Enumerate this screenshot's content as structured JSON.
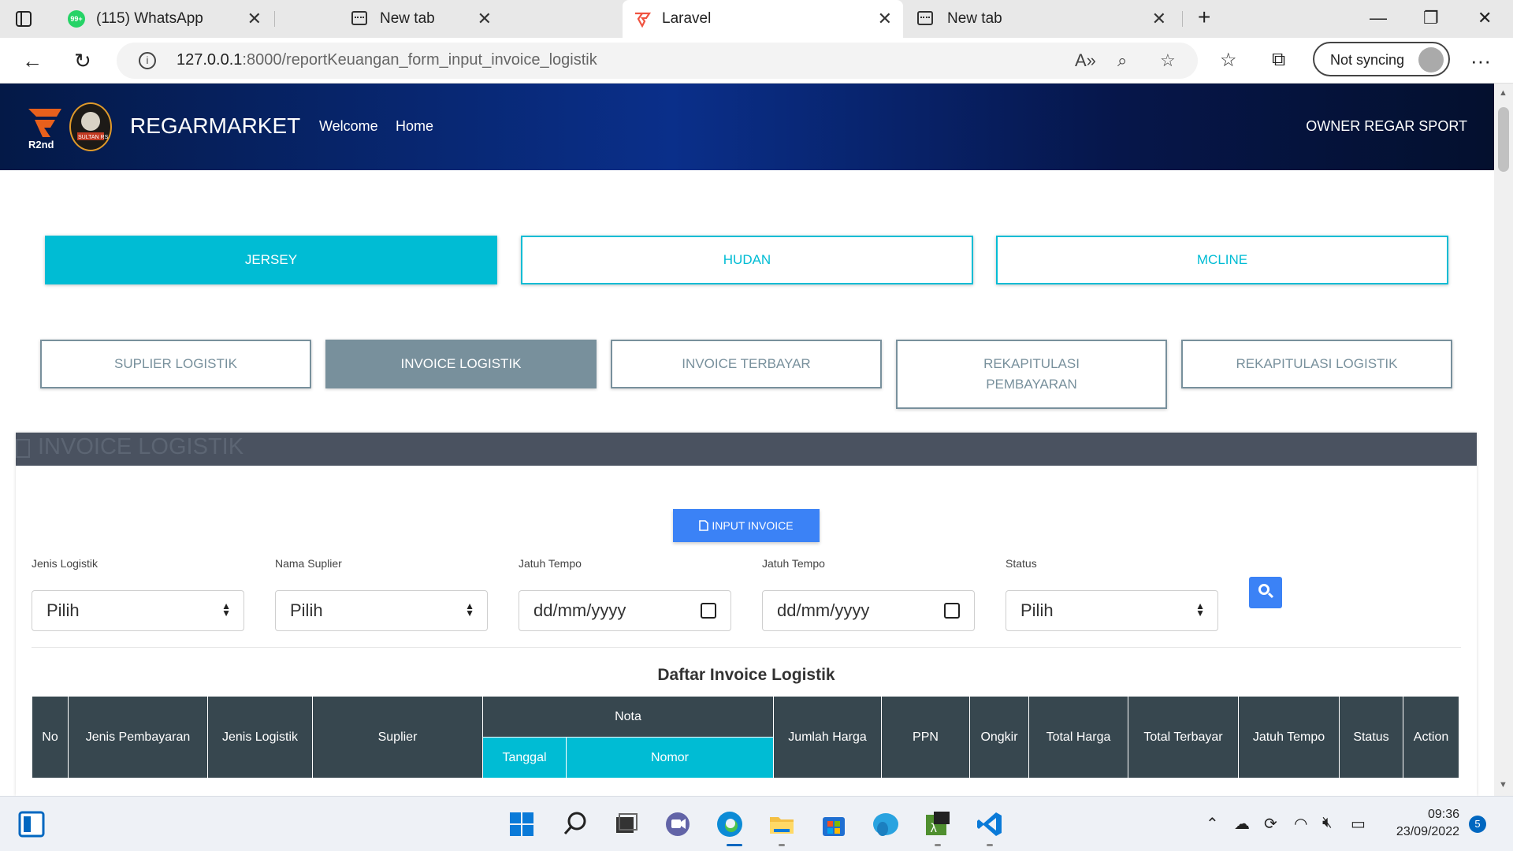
{
  "browser": {
    "tabs": [
      {
        "title": "(115) WhatsApp",
        "badge": "99+"
      },
      {
        "title": "New tab"
      },
      {
        "title": "Laravel"
      },
      {
        "title": "New tab"
      }
    ],
    "url_host": "127.0.0.1",
    "url_path": ":8000/reportKeuangan_form_input_invoice_logistik",
    "sync_label": "Not syncing"
  },
  "header": {
    "brand": "REGARMARKET",
    "nav": [
      "Welcome",
      "Home"
    ],
    "owner": "OWNER REGAR SPORT",
    "logo1_text": "R2nd",
    "logo2_text": "SULTAN RS"
  },
  "categories": [
    "JERSEY",
    "HUDAN",
    "MCLINE"
  ],
  "subnav": [
    "SUPLIER LOGISTIK",
    "INVOICE LOGISTIK",
    "INVOICE TERBAYAR",
    "REKAPITULASI PEMBAYARAN",
    "REKAPITULASI LOGISTIK"
  ],
  "panel": {
    "title": "INVOICE LOGISTIK",
    "input_button": "INPUT INVOICE",
    "filters": [
      {
        "label": "Jenis Logistik",
        "value": "Pilih"
      },
      {
        "label": "Nama Suplier",
        "value": "Pilih"
      },
      {
        "label": "Jatuh Tempo",
        "value": "dd/mm/yyyy"
      },
      {
        "label": "Jatuh Tempo",
        "value": "dd/mm/yyyy"
      },
      {
        "label": "Status",
        "value": "Pilih"
      }
    ],
    "table_title": "Daftar Invoice Logistik",
    "columns": {
      "no": "No",
      "jenis_pembayaran": "Jenis Pembayaran",
      "jenis_logistik": "Jenis Logistik",
      "suplier": "Suplier",
      "nota": "Nota",
      "tanggal": "Tanggal",
      "nomor": "Nomor",
      "jumlah_harga": "Jumlah Harga",
      "ppn": "PPN",
      "ongkir": "Ongkir",
      "total_harga": "Total Harga",
      "total_terbayar": "Total Terbayar",
      "jatuh_tempo": "Jatuh Tempo",
      "status": "Status",
      "action": "Action"
    }
  },
  "taskbar": {
    "time": "09:36",
    "date": "23/09/2022",
    "notifications": "5"
  },
  "colors": {
    "accent_cyan": "#00bcd4",
    "slate": "#78909c",
    "table_header": "#37474f",
    "primary_blue": "#3b82f6"
  }
}
